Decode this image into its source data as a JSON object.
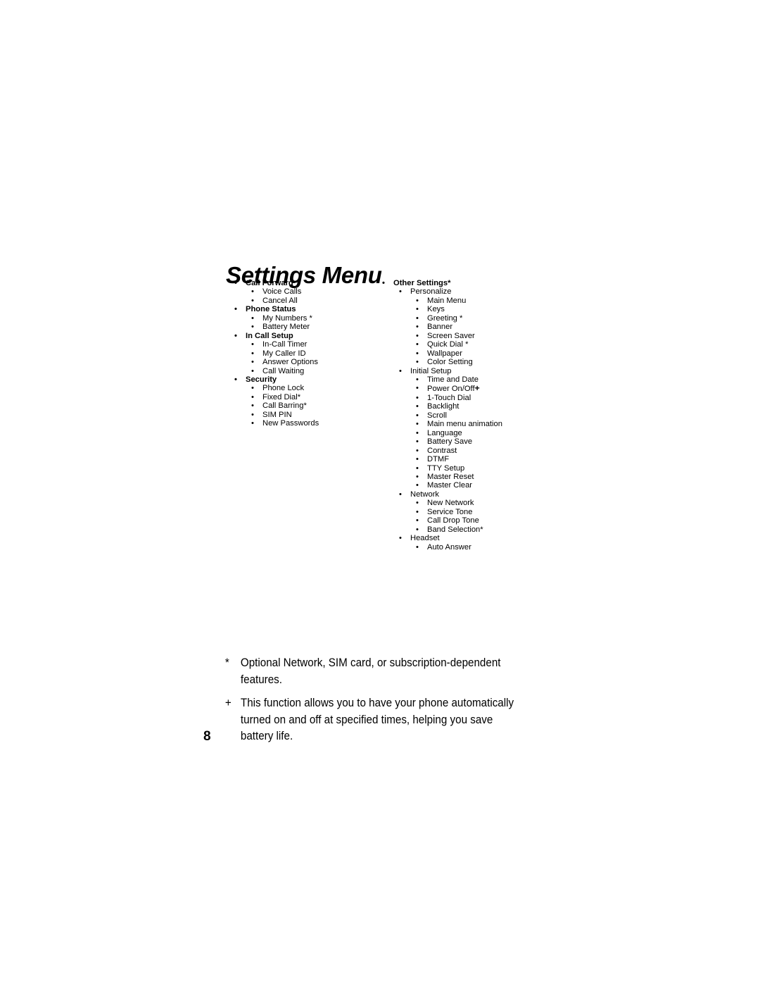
{
  "document": {
    "title": "Settings Menu",
    "page_number": "8"
  },
  "bullet_glyph": "•",
  "menu": {
    "left_column": [
      {
        "level": 1,
        "label": "Call Forward *"
      },
      {
        "level": 2,
        "label": "Voice Calls"
      },
      {
        "level": 2,
        "label": "Cancel All"
      },
      {
        "level": 1,
        "label": "Phone Status"
      },
      {
        "level": 2,
        "label": "My Numbers *"
      },
      {
        "level": 2,
        "label": "Battery Meter"
      },
      {
        "level": 1,
        "label": "In Call Setup"
      },
      {
        "level": 2,
        "label": "In-Call Timer"
      },
      {
        "level": 2,
        "label": "My Caller ID"
      },
      {
        "level": 2,
        "label": "Answer Options"
      },
      {
        "level": 2,
        "label": "Call Waiting"
      },
      {
        "level": 1,
        "label": "Security"
      },
      {
        "level": 2,
        "label": "Phone Lock"
      },
      {
        "level": 2,
        "label": "Fixed Dial*"
      },
      {
        "level": 2,
        "label": "Call Barring*"
      },
      {
        "level": 2,
        "label": "SIM PIN"
      },
      {
        "level": 2,
        "label": "New Passwords"
      }
    ],
    "right_column": [
      {
        "level": 1,
        "label": "Other Settings*"
      },
      {
        "level": 2,
        "label": "Personalize"
      },
      {
        "level": 3,
        "label": "Main Menu"
      },
      {
        "level": 3,
        "label": "Keys"
      },
      {
        "level": 3,
        "label": "Greeting *"
      },
      {
        "level": 3,
        "label": "Banner"
      },
      {
        "level": 3,
        "label": "Screen Saver"
      },
      {
        "level": 3,
        "label": "Quick Dial *"
      },
      {
        "level": 3,
        "label": "Wallpaper"
      },
      {
        "level": 3,
        "label": "Color Setting"
      },
      {
        "level": 2,
        "label": "Initial Setup"
      },
      {
        "level": 3,
        "label": "Time and Date"
      },
      {
        "level": 3,
        "label": "Power On/Off+"
      },
      {
        "level": 3,
        "label": "1-Touch Dial"
      },
      {
        "level": 3,
        "label": "Backlight"
      },
      {
        "level": 3,
        "label": "Scroll"
      },
      {
        "level": 3,
        "label": "Main menu animation"
      },
      {
        "level": 3,
        "label": "Language"
      },
      {
        "level": 3,
        "label": "Battery Save"
      },
      {
        "level": 3,
        "label": "Contrast"
      },
      {
        "level": 3,
        "label": "DTMF"
      },
      {
        "level": 3,
        "label": "TTY Setup"
      },
      {
        "level": 3,
        "label": "Master Reset"
      },
      {
        "level": 3,
        "label": "Master Clear"
      },
      {
        "level": 2,
        "label": "Network"
      },
      {
        "level": 3,
        "label": "New Network"
      },
      {
        "level": 3,
        "label": "Service Tone"
      },
      {
        "level": 3,
        "label": "Call Drop Tone"
      },
      {
        "level": 3,
        "label": "Band Selection*"
      },
      {
        "level": 2,
        "label": "Headset"
      },
      {
        "level": 3,
        "label": "Auto Answer"
      }
    ]
  },
  "footnotes": [
    {
      "marker": "*",
      "text": "Optional Network, SIM card, or subscription-dependent features."
    },
    {
      "marker": "+",
      "text": "This function allows you to have your phone automatically turned on and off at specified times, helping you save battery life."
    }
  ]
}
